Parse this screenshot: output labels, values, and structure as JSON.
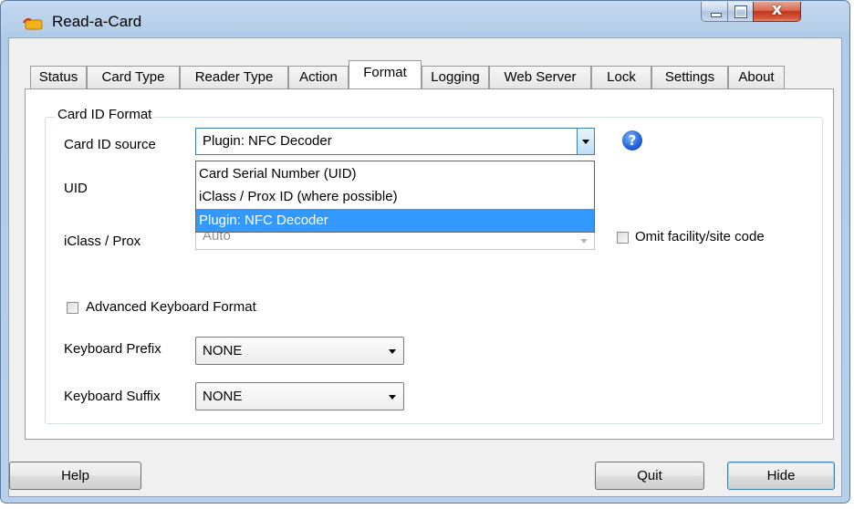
{
  "window": {
    "title": "Read-a-Card",
    "close_glyph": "x",
    "icon": "card-reader-icon"
  },
  "tabs": [
    {
      "label": "Status"
    },
    {
      "label": "Card Type"
    },
    {
      "label": "Reader Type"
    },
    {
      "label": "Action"
    },
    {
      "label": "Format",
      "active": true
    },
    {
      "label": "Logging"
    },
    {
      "label": "Web Server"
    },
    {
      "label": "Lock"
    },
    {
      "label": "Settings"
    },
    {
      "label": "About"
    }
  ],
  "format": {
    "group_title": "Card ID Format",
    "card_id_source": {
      "label": "Card ID source",
      "value": "Plugin: NFC Decoder",
      "options": [
        "Card Serial Number (UID)",
        "iClass / Prox ID (where possible)",
        "Plugin: NFC Decoder"
      ],
      "selected_index": 2,
      "expanded": true
    },
    "uid_label": "UID",
    "iclass_prox": {
      "label": "iClass / Prox",
      "value": "Auto",
      "disabled": true
    },
    "omit_facility": {
      "label": "Omit facility/site code",
      "checked": false
    },
    "help_icon": "?",
    "advanced_keyboard": {
      "label": "Advanced Keyboard Format",
      "checked": false
    },
    "keyboard_prefix": {
      "label": "Keyboard Prefix",
      "value": "NONE"
    },
    "keyboard_suffix": {
      "label": "Keyboard Suffix",
      "value": "NONE"
    }
  },
  "buttons": {
    "help": "Help",
    "quit": "Quit",
    "hide": "Hide"
  },
  "colors": {
    "selection": "#3399ff",
    "title_bar": "#b8d1eb",
    "close_button": "#c2361a",
    "help_icon": "#1f5fd6"
  }
}
